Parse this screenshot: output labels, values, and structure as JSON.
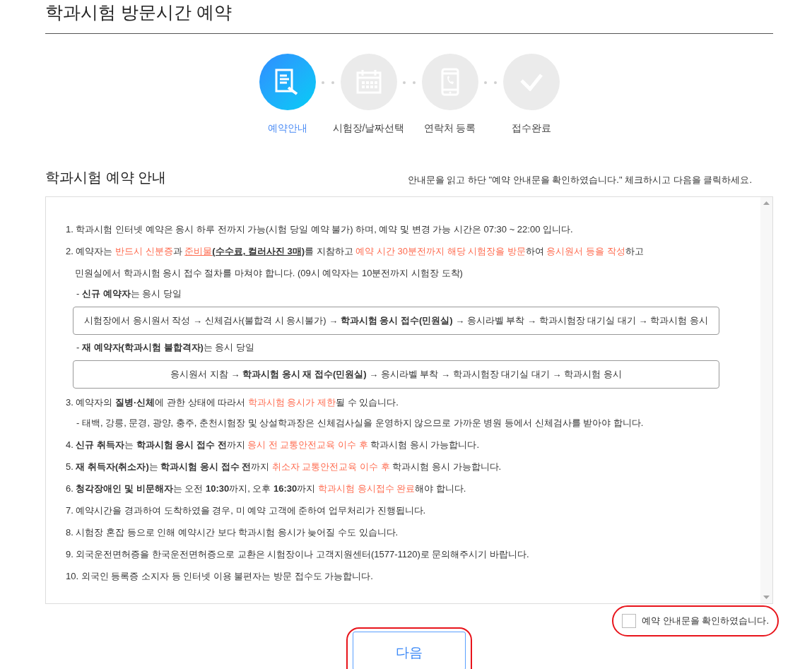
{
  "page_title": "학과시험 방문시간 예약",
  "steps": [
    {
      "label": "예약안내",
      "kind": "document",
      "selected": true
    },
    {
      "label": "시험장/날짜선택",
      "kind": "calendar",
      "selected": false
    },
    {
      "label": "연락처 등록",
      "kind": "phone",
      "selected": false
    },
    {
      "label": "접수완료",
      "kind": "check",
      "selected": false
    }
  ],
  "notice": {
    "title": "학과시험 예약 안내",
    "instruction": "안내문을 읽고 하단 \"예약 안내문을 확인하였습니다.\" 체크하시고 다음을 클릭하세요.",
    "lines": [
      {
        "kind": "item",
        "segments": [
          {
            "t": "1. 학과시험 인터넷 예약은 응시 하루 전까지 가능(시험 당일 예약 불가) 하며, 예약 및 변경 가능 시간은 07:30 ~ 22:00 입니다.",
            "red": false,
            "underline": false
          }
        ]
      },
      {
        "kind": "item",
        "segments": [
          {
            "t": "2. 예약자는 ",
            "red": false,
            "underline": false
          },
          {
            "t": "반드시 신분증",
            "red": true,
            "underline": false
          },
          {
            "t": "과 ",
            "red": false,
            "underline": false
          },
          {
            "t": "준비물",
            "red": true,
            "underline": true
          },
          {
            "t": "**(수수료, 컬러사진 3매)**",
            "red": false,
            "underline": true
          },
          {
            "t": "를 지참하고 ",
            "red": false,
            "underline": false
          },
          {
            "t": "예약 시간 30분전까지 해당 시험장을 방문",
            "red": true,
            "underline": false
          },
          {
            "t": "하여 ",
            "red": false,
            "underline": false
          },
          {
            "t": "응시원서 등을 작성",
            "red": true,
            "underline": false
          },
          {
            "t": "하고",
            "red": false,
            "underline": false
          }
        ]
      },
      {
        "kind": "indent",
        "segments": [
          {
            "t": "민원실에서 학과시험 응시 접수 절차를 마쳐야 합니다. (09시 예약자는 10분전까지 시험장 도착)",
            "red": false,
            "underline": false
          }
        ]
      },
      {
        "kind": "sub",
        "segments": [
          {
            "t": "- **신규 예약자**는 응시 당일",
            "red": false,
            "underline": false
          }
        ]
      },
      {
        "kind": "flow",
        "segments": [
          {
            "t": "시험장에서 응시원서 작성 → 신체검사(불합격 시 응시불가) → **학과시험 응시 접수(민원실)** → 응시라벨 부착 → 학과시험장 대기실 대기 → 학과시험 응시",
            "red": false,
            "underline": false
          }
        ]
      },
      {
        "kind": "sub",
        "segments": [
          {
            "t": "- **재 예약자(학과시험 불합격자)**는 응시 당일",
            "red": false,
            "underline": false
          }
        ]
      },
      {
        "kind": "flow",
        "segments": [
          {
            "t": "응시원서 지참 → **학과시험 응시 재 접수(민원실)** → 응시라벨 부착 → 학과시험장 대기실 대기 → 학과시험 응시",
            "red": false,
            "underline": false
          }
        ]
      },
      {
        "kind": "item",
        "segments": [
          {
            "t": "3. 예약자의 **질병·신체**에 관한 상태에 따라서 ",
            "red": false,
            "underline": false
          },
          {
            "t": "학과시험 응시가 제한",
            "red": true,
            "underline": false
          },
          {
            "t": "될 수 있습니다.",
            "red": false,
            "underline": false
          }
        ]
      },
      {
        "kind": "sub",
        "segments": [
          {
            "t": "- 태백, 강릉, 문경, 광양, 충주, 춘천시험장 및 상설학과장은 신체검사실을 운영하지 않으므로 가까운 병원 등에서 신체검사를 받아야 합니다.",
            "red": false,
            "underline": false
          }
        ]
      },
      {
        "kind": "item",
        "segments": [
          {
            "t": "4. **신규 취득자**는 **학과시험 응시 접수 전**까지 ",
            "red": false,
            "underline": false
          },
          {
            "t": "응시 전 교통안전교육 이수 후",
            "red": true,
            "underline": false
          },
          {
            "t": " 학과시험 응시 가능합니다.",
            "red": false,
            "underline": false
          }
        ]
      },
      {
        "kind": "item",
        "segments": [
          {
            "t": "5. **재 취득자(취소자)**는 **학과시험 응시 접수 전**까지 ",
            "red": false,
            "underline": false
          },
          {
            "t": "취소자 교통안전교육 이수 후",
            "red": true,
            "underline": false
          },
          {
            "t": " 학과시험 응시 가능합니다.",
            "red": false,
            "underline": false
          }
        ]
      },
      {
        "kind": "item",
        "segments": [
          {
            "t": "6. **청각장애인 및 비문해자**는 오전 **10:30**까지, 오후 **16:30**까지 ",
            "red": false,
            "underline": false
          },
          {
            "t": "학과시험 응시접수 완료",
            "red": true,
            "underline": false
          },
          {
            "t": "해야 합니다.",
            "red": false,
            "underline": false
          }
        ]
      },
      {
        "kind": "item",
        "segments": [
          {
            "t": "7. 예약시간을 경과하여 도착하였을 경우, 미 예약 고객에 준하여 업무처리가 진행됩니다.",
            "red": false,
            "underline": false
          }
        ]
      },
      {
        "kind": "item",
        "segments": [
          {
            "t": "8. 시험장 혼잡 등으로 인해 예약시간 보다 학과시험 응시가 늦어질 수도 있습니다.",
            "red": false,
            "underline": false
          }
        ]
      },
      {
        "kind": "item",
        "segments": [
          {
            "t": "9. 외국운전면허증을 한국운전면허증으로 교환은 시험장이나 고객지원센터(1577-1120)로 문의해주시기 바랍니다.",
            "red": false,
            "underline": false
          }
        ]
      },
      {
        "kind": "item",
        "segments": [
          {
            "t": "10. 외국인 등록증 소지자 등 인터넷 이용 불편자는 방문 접수도 가능합니다.",
            "red": false,
            "underline": false
          }
        ]
      }
    ]
  },
  "confirm": {
    "label": "예약 안내문을 확인하였습니다.",
    "checked": false
  },
  "next_button": "다음"
}
